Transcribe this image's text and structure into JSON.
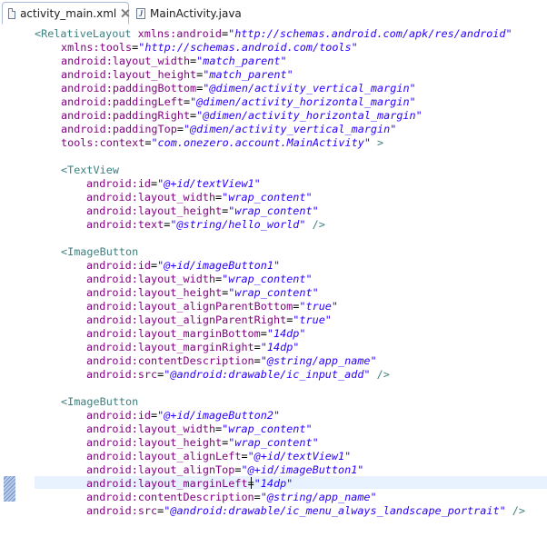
{
  "tabs": [
    {
      "label": "activity_main.xml",
      "icon": "xml-file-icon",
      "active": true
    },
    {
      "label": "MainActivity.java",
      "icon": "java-file-icon",
      "active": false
    }
  ],
  "colors": {
    "tag": "#3f7f7f",
    "attribute": "#7f007f",
    "value": "#2a00ff",
    "current_line": "#e8f2fe"
  },
  "editor": {
    "lines": [
      [
        {
          "k": "t",
          "s": "<RelativeLayout "
        },
        {
          "k": "a",
          "s": "xmlns:android"
        },
        {
          "k": "p",
          "s": "="
        },
        {
          "k": "v",
          "s": "\"http://schemas.android.com/apk/res/android\""
        }
      ],
      [
        {
          "k": "a",
          "s": "xmlns:tools"
        },
        {
          "k": "p",
          "s": "="
        },
        {
          "k": "v",
          "s": "\"http://schemas.android.com/tools\""
        }
      ],
      [
        {
          "k": "a",
          "s": "android:layout_width"
        },
        {
          "k": "p",
          "s": "="
        },
        {
          "k": "v",
          "s": "\"match_parent\""
        }
      ],
      [
        {
          "k": "a",
          "s": "android:layout_height"
        },
        {
          "k": "p",
          "s": "="
        },
        {
          "k": "v",
          "s": "\"match_parent\""
        }
      ],
      [
        {
          "k": "a",
          "s": "android:paddingBottom"
        },
        {
          "k": "p",
          "s": "="
        },
        {
          "k": "v",
          "s": "\"@dimen/activity_vertical_margin\""
        }
      ],
      [
        {
          "k": "a",
          "s": "android:paddingLeft"
        },
        {
          "k": "p",
          "s": "="
        },
        {
          "k": "v",
          "s": "\"@dimen/activity_horizontal_margin\""
        }
      ],
      [
        {
          "k": "a",
          "s": "android:paddingRight"
        },
        {
          "k": "p",
          "s": "="
        },
        {
          "k": "v",
          "s": "\"@dimen/activity_horizontal_margin\""
        }
      ],
      [
        {
          "k": "a",
          "s": "android:paddingTop"
        },
        {
          "k": "p",
          "s": "="
        },
        {
          "k": "v",
          "s": "\"@dimen/activity_vertical_margin\""
        }
      ],
      [
        {
          "k": "a",
          "s": "tools:context"
        },
        {
          "k": "p",
          "s": "="
        },
        {
          "k": "v",
          "s": "\"com.onezero.account.MainActivity\""
        },
        {
          "k": "t",
          "s": " >"
        }
      ],
      [],
      [
        {
          "k": "t",
          "s": "<TextView"
        }
      ],
      [
        {
          "k": "a",
          "s": "android:id"
        },
        {
          "k": "p",
          "s": "="
        },
        {
          "k": "v",
          "s": "\"@+id/textView1\""
        }
      ],
      [
        {
          "k": "a",
          "s": "android:layout_width"
        },
        {
          "k": "p",
          "s": "="
        },
        {
          "k": "v",
          "s": "\"wrap_content\""
        }
      ],
      [
        {
          "k": "a",
          "s": "android:layout_height"
        },
        {
          "k": "p",
          "s": "="
        },
        {
          "k": "v",
          "s": "\"wrap_content\""
        }
      ],
      [
        {
          "k": "a",
          "s": "android:text"
        },
        {
          "k": "p",
          "s": "="
        },
        {
          "k": "v",
          "s": "\"@string/hello_world\""
        },
        {
          "k": "t",
          "s": " />"
        }
      ],
      [],
      [
        {
          "k": "t",
          "s": "<ImageButton"
        }
      ],
      [
        {
          "k": "a",
          "s": "android:id"
        },
        {
          "k": "p",
          "s": "="
        },
        {
          "k": "v",
          "s": "\"@+id/imageButton1\""
        }
      ],
      [
        {
          "k": "a",
          "s": "android:layout_width"
        },
        {
          "k": "p",
          "s": "="
        },
        {
          "k": "v",
          "s": "\"wrap_content\""
        }
      ],
      [
        {
          "k": "a",
          "s": "android:layout_height"
        },
        {
          "k": "p",
          "s": "="
        },
        {
          "k": "v",
          "s": "\"wrap_content\""
        }
      ],
      [
        {
          "k": "a",
          "s": "android:layout_alignParentBottom"
        },
        {
          "k": "p",
          "s": "="
        },
        {
          "k": "v",
          "s": "\"true\""
        }
      ],
      [
        {
          "k": "a",
          "s": "android:layout_alignParentRight"
        },
        {
          "k": "p",
          "s": "="
        },
        {
          "k": "v",
          "s": "\"true\""
        }
      ],
      [
        {
          "k": "a",
          "s": "android:layout_marginBottom"
        },
        {
          "k": "p",
          "s": "="
        },
        {
          "k": "v",
          "s": "\"14dp\""
        }
      ],
      [
        {
          "k": "a",
          "s": "android:layout_marginRight"
        },
        {
          "k": "p",
          "s": "="
        },
        {
          "k": "v",
          "s": "\"14dp\""
        }
      ],
      [
        {
          "k": "a",
          "s": "android:contentDescription"
        },
        {
          "k": "p",
          "s": "="
        },
        {
          "k": "v",
          "s": "\"@string/app_name\""
        }
      ],
      [
        {
          "k": "a",
          "s": "android:src"
        },
        {
          "k": "p",
          "s": "="
        },
        {
          "k": "v",
          "s": "\"@android:drawable/ic_input_add\""
        },
        {
          "k": "t",
          "s": " />"
        }
      ],
      [],
      [
        {
          "k": "t",
          "s": "<ImageButton"
        }
      ],
      [
        {
          "k": "a",
          "s": "android:id"
        },
        {
          "k": "p",
          "s": "="
        },
        {
          "k": "v",
          "s": "\"@+id/imageButton2\""
        }
      ],
      [
        {
          "k": "a",
          "s": "android:layout_width"
        },
        {
          "k": "p",
          "s": "="
        },
        {
          "k": "v",
          "s": "\"wrap_content\""
        }
      ],
      [
        {
          "k": "a",
          "s": "android:layout_height"
        },
        {
          "k": "p",
          "s": "="
        },
        {
          "k": "v",
          "s": "\"wrap_content\""
        }
      ],
      [
        {
          "k": "a",
          "s": "android:layout_alignLeft"
        },
        {
          "k": "p",
          "s": "="
        },
        {
          "k": "v",
          "s": "\"@+id/textView1\""
        }
      ],
      [
        {
          "k": "a",
          "s": "android:layout_alignTop"
        },
        {
          "k": "p",
          "s": "="
        },
        {
          "k": "v",
          "s": "\"@+id/imageButton1\""
        }
      ],
      [
        {
          "k": "a",
          "s": "android:layout_marginLeft"
        },
        {
          "k": "p",
          "s": "="
        },
        {
          "k": "v",
          "s": "\"14dp\""
        }
      ],
      [
        {
          "k": "a",
          "s": "android:contentDescription"
        },
        {
          "k": "p",
          "s": "="
        },
        {
          "k": "v",
          "s": "\"@string/app_name\""
        }
      ],
      [
        {
          "k": "a",
          "s": "android:src"
        },
        {
          "k": "p",
          "s": "="
        },
        {
          "k": "v",
          "s": "\"@android:drawable/ic_menu_always_landscape_portrait\""
        },
        {
          "k": "t",
          "s": " />"
        }
      ]
    ]
  }
}
